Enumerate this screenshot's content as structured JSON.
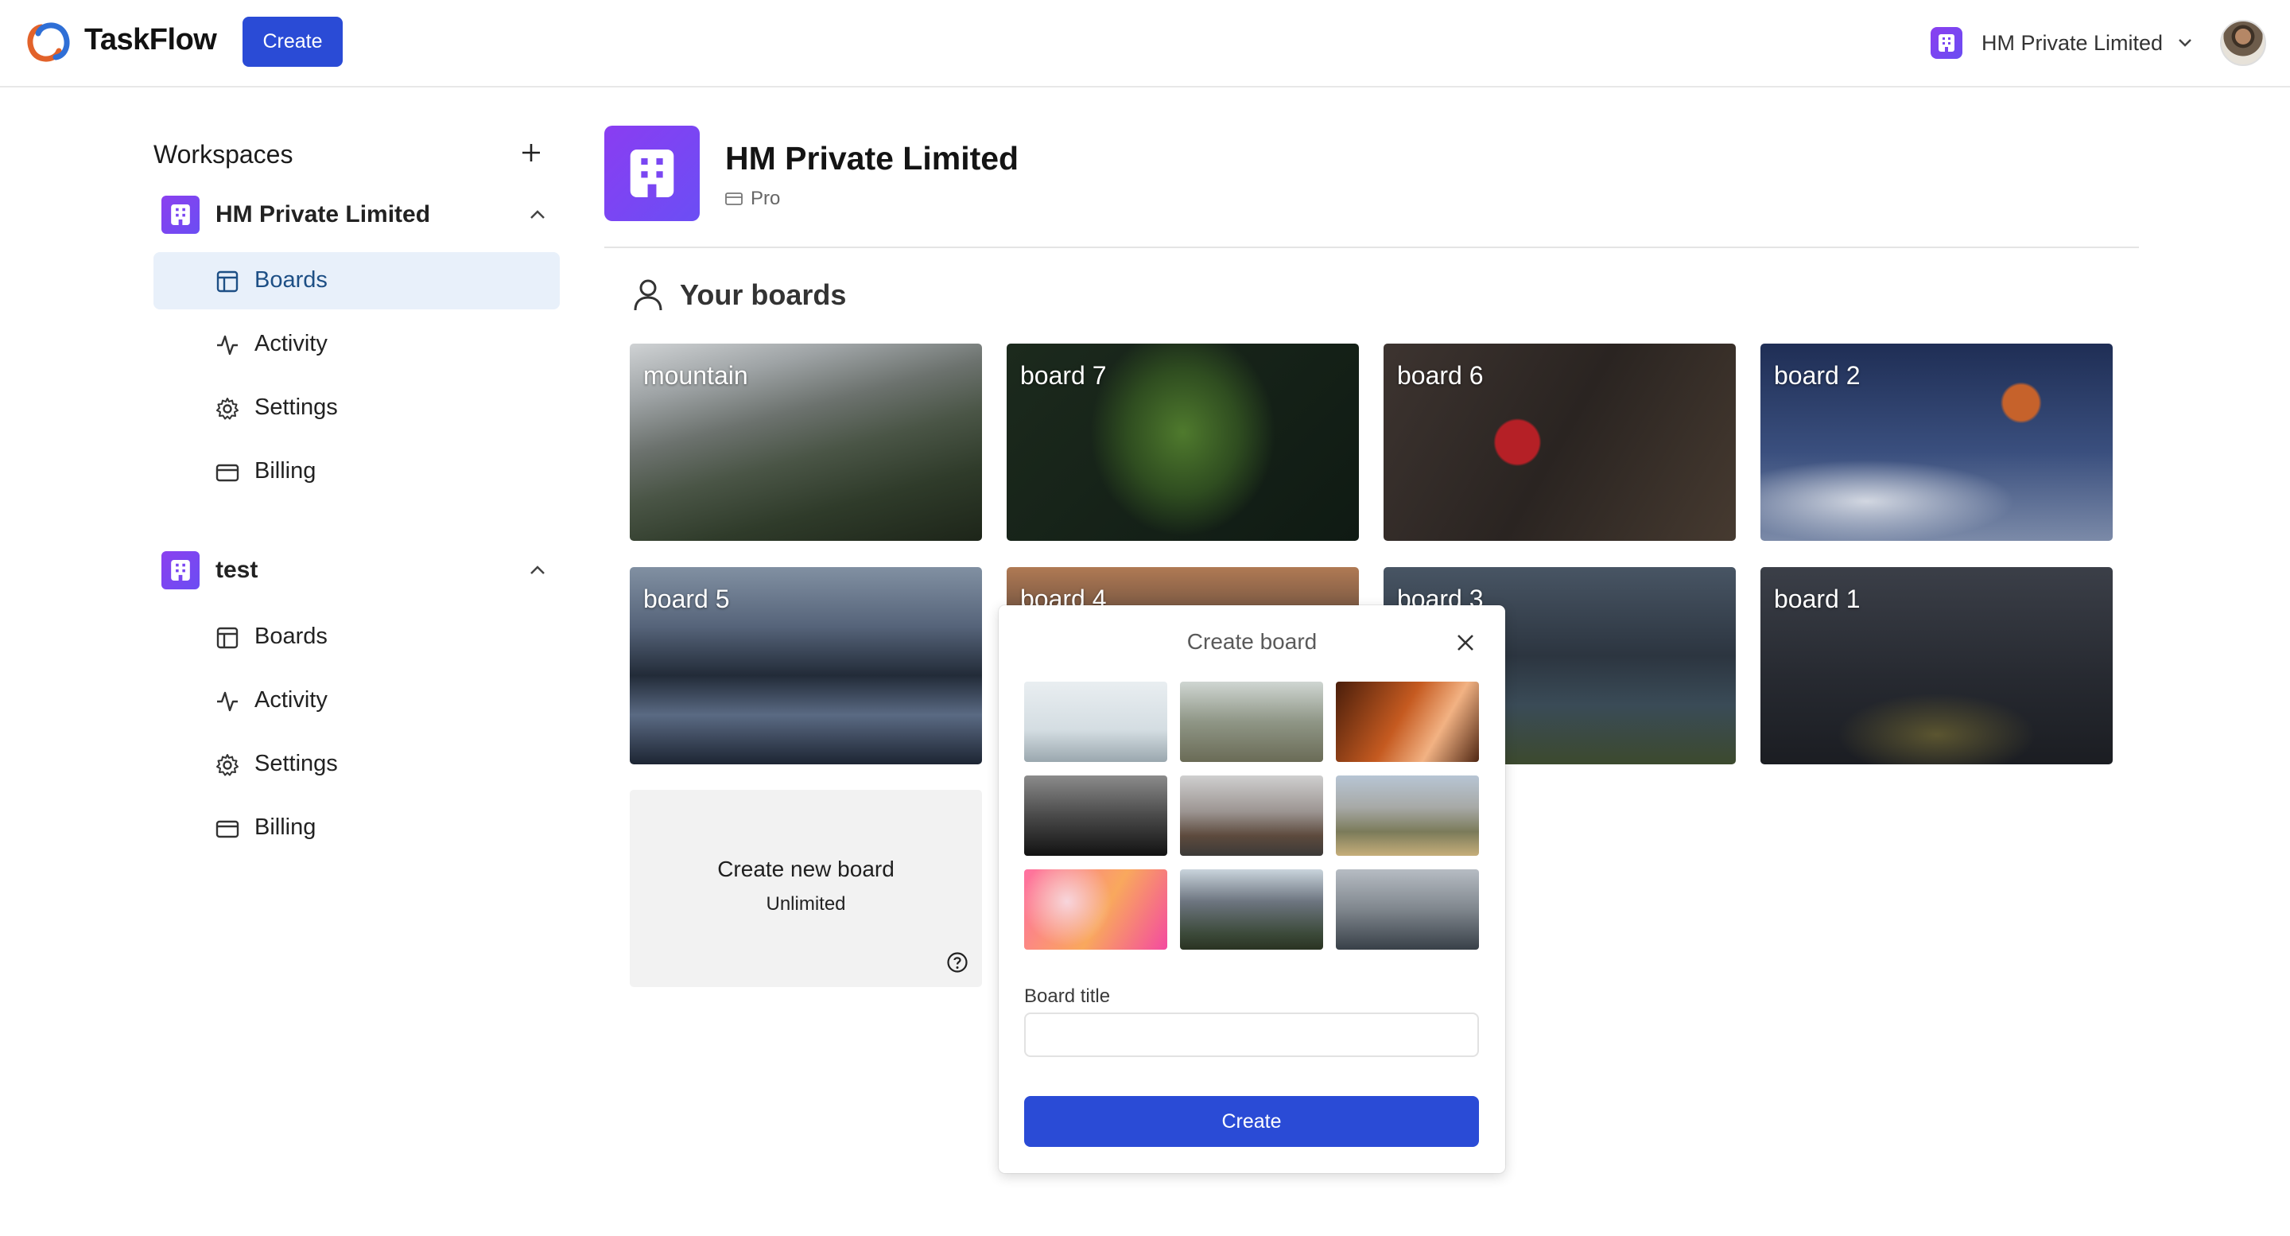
{
  "header": {
    "brand": "TaskFlow",
    "create_label": "Create",
    "org_switcher_label": "HM Private Limited"
  },
  "sidebar": {
    "title": "Workspaces",
    "workspaces": [
      {
        "name": "HM Private Limited",
        "items": [
          {
            "label": "Boards",
            "icon": "layout-icon",
            "active": true
          },
          {
            "label": "Activity",
            "icon": "activity-icon"
          },
          {
            "label": "Settings",
            "icon": "gear-icon"
          },
          {
            "label": "Billing",
            "icon": "credit-card-icon"
          }
        ]
      },
      {
        "name": "test",
        "items": [
          {
            "label": "Boards",
            "icon": "layout-icon"
          },
          {
            "label": "Activity",
            "icon": "activity-icon"
          },
          {
            "label": "Settings",
            "icon": "gear-icon"
          },
          {
            "label": "Billing",
            "icon": "credit-card-icon"
          }
        ]
      }
    ]
  },
  "main": {
    "org_name": "HM Private Limited",
    "plan": "Pro",
    "section_title": "Your boards",
    "boards": [
      {
        "title": "mountain"
      },
      {
        "title": "board 7"
      },
      {
        "title": "board 6"
      },
      {
        "title": "board 2"
      },
      {
        "title": "board 5"
      },
      {
        "title": "board 4"
      },
      {
        "title": "board 3"
      },
      {
        "title": "board 1"
      }
    ],
    "new_board": {
      "title": "Create new board",
      "subtitle": "Unlimited"
    }
  },
  "popover": {
    "title": "Create board",
    "field_label": "Board title",
    "field_value": "",
    "submit_label": "Create"
  },
  "colors": {
    "primary": "#2a4bd6",
    "org_badge": "#7a46f2",
    "active_nav_bg": "#e8f0fa"
  }
}
